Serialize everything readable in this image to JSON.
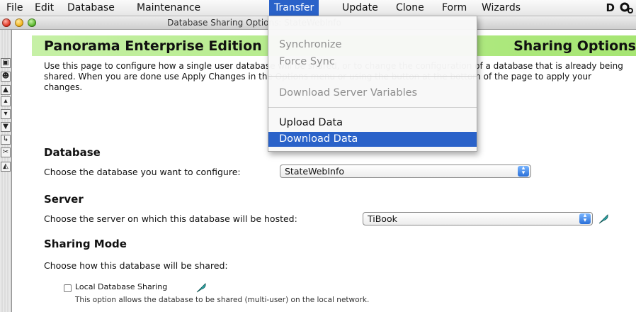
{
  "menubar": {
    "items": [
      "File",
      "Edit",
      "Database",
      "Maintenance",
      "Transfer",
      "Update",
      "Clone",
      "Form",
      "Wizards"
    ],
    "active": "Transfer",
    "right_text": "D"
  },
  "window": {
    "title": "Database Sharing Options: StateWebInfo"
  },
  "header": {
    "title": "Panorama Enterprise Edition",
    "right": "Sharing Options"
  },
  "intro": "Use this page to configure how a single user database will be shared, or to change the configuration of a database that is already being shared. When you are done use Apply Changes in the Options menu or using the button at the bottom of the page to apply your changes.",
  "database": {
    "heading": "Database",
    "label": "Choose the database you want to configure:",
    "value": "StateWebInfo"
  },
  "server": {
    "heading": "Server",
    "label": "Choose the server on which this database will be hosted:",
    "value": "TiBook"
  },
  "sharing": {
    "heading": "Sharing Mode",
    "label": "Choose how this database will be shared:",
    "option_label": "Local Database Sharing",
    "option_desc": "This option allows the database to be shared (multi-user) on the local network."
  },
  "transfer_menu": {
    "items": [
      {
        "label": "Synchronize",
        "state": "disabled"
      },
      {
        "label": "Force Sync",
        "state": "disabled"
      },
      {
        "label": "Download Server Variables",
        "state": "disabled"
      },
      {
        "label": "Upload Data",
        "state": "enabled"
      },
      {
        "label": "Download Data",
        "state": "highlighted"
      }
    ]
  },
  "colors": {
    "highlight": "#2a62c9",
    "header_band": "#b7ec8e"
  }
}
